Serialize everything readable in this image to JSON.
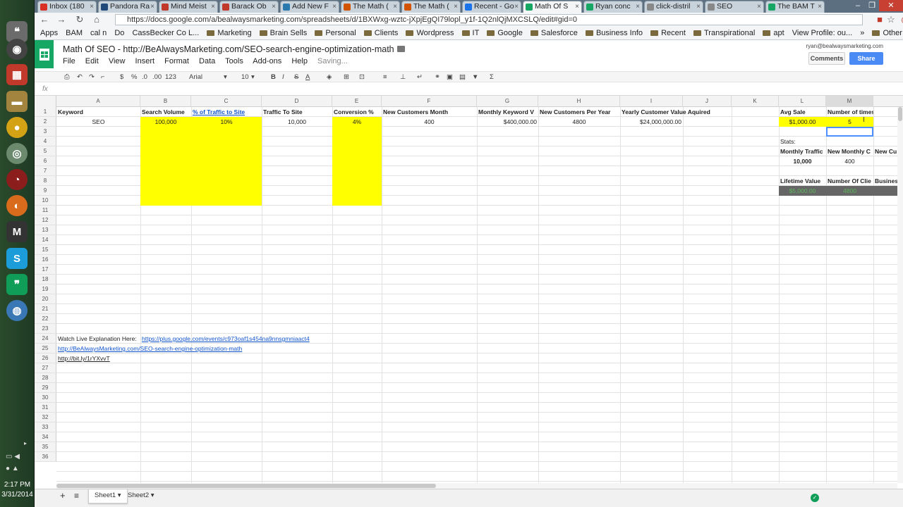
{
  "taskbar": {
    "icons": [
      "chat-icon",
      "webcam-icon",
      "tiles-icon",
      "folder-icon",
      "chrome-yellow-icon",
      "chrome-icon",
      "clock-icon",
      "firefox-icon",
      "m-icon",
      "skype-icon",
      "hangouts-icon",
      "globe-icon"
    ],
    "time": "2:17 PM",
    "date": "3/31/2014"
  },
  "browser": {
    "tabs": [
      "Inbox (180",
      "Pandora Ra",
      "Mind Meist",
      "Barack Ob",
      "Add New F",
      "The Math (",
      "The Math (",
      "Recent - Go",
      "Math Of S",
      "Ryan conc",
      "click-distril",
      "SEO",
      "The BAM T"
    ],
    "active_tab_index": 8,
    "url": "https://docs.google.com/a/bealwaysmarketing.com/spreadsheets/d/1BXWxg-wztc-jXpjEgQI79lopl_y1f-1Q2nlQjMXCSLQ/edit#gid=0",
    "bookmarks": [
      "Apps",
      "BAM",
      "cal n",
      "Do",
      "CassBecker Co L...",
      "Marketing",
      "Brain Sells",
      "Personal",
      "Clients",
      "Wordpress",
      "IT",
      "Google",
      "Salesforce",
      "Business Info",
      "Recent",
      "Transpirational",
      "apt",
      "View Profile: ou...",
      "»",
      "Other bookmarks"
    ]
  },
  "doc": {
    "title": "Math Of SEO - http://BeAlwaysMarketing.com/SEO-search-engine-optimization-math",
    "menu": [
      "File",
      "Edit",
      "View",
      "Insert",
      "Format",
      "Data",
      "Tools",
      "Add-ons",
      "Help"
    ],
    "saving": "Saving...",
    "user_email": "ryan@bealwaysmarketing.com",
    "comments_label": "Comments",
    "share_label": "Share"
  },
  "toolbar": {
    "currency": "$",
    "percent": "%",
    "dec_dec": ".0",
    "dec_inc": ".00",
    "format_more": "123",
    "font": "Arial",
    "font_size": "10",
    "bold": "B",
    "italic": "I",
    "strike": "S",
    "text_color": "A",
    "sum": "Σ"
  },
  "formula": {
    "label": "fx",
    "value": ""
  },
  "columns": [
    "A",
    "B",
    "C",
    "D",
    "E",
    "F",
    "G",
    "H",
    "I",
    "J",
    "K",
    "L",
    "M"
  ],
  "row_count": 36,
  "cells": {
    "A1": "Keyword",
    "B1": "Search Volume",
    "C1": "% of Traffic to Site",
    "D1": "Traffic To Site",
    "E1": "Conversion %",
    "F1": "New Customers Month",
    "G1": "Monthly Keyword V",
    "H1": "New Customers Per Year",
    "I1": "Yearly Customer Value Aquired",
    "L1": "Avg Sale",
    "M1": "Number of times custon",
    "A2": "SEO",
    "B2": "100,000",
    "C2": "10%",
    "D2": "10,000",
    "E2": "4%",
    "F2": "400",
    "G2": "$400,000.00",
    "H2": "4800",
    "I2": "$24,000,000.00",
    "L2": "$1,000.00",
    "M2": "5",
    "L4": "Stats:",
    "L5": "Monthly Traffic",
    "M5": "New Monthly C",
    "N5": "New Cu",
    "L6": "10,000",
    "M6": "400",
    "L8": "Lifetime Value",
    "M8": "Number Of Clie",
    "N8": "Busines",
    "L9": "$5,000.00",
    "M9": "4800",
    "N9": "$2",
    "A24": "Watch Live Explanation Here:",
    "B24": "https://plus.google.com/events/c973oaf1s454na9nnsgmniaact4",
    "A25": "http://BeAlwaysMarketing.com/SEO-search-engine-optimization-math",
    "A26": "http://bit.ly/1rYXvvT"
  },
  "sheets": [
    "Sheet1",
    "Sheet2"
  ],
  "colors": {
    "highlight": "#ffff00",
    "sheets_green": "#16a765",
    "link": "#1155cc",
    "share_blue": "#4a8af4"
  }
}
